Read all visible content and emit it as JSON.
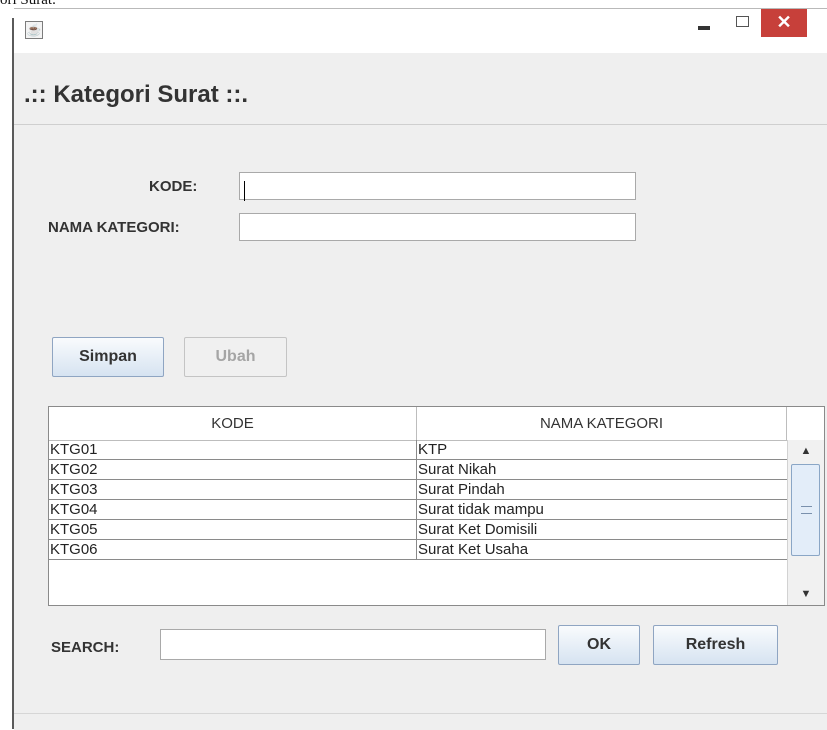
{
  "page": {
    "caption": "ori Surat."
  },
  "window": {
    "app_icon": "java-coffee-icon",
    "close_glyph": "✕"
  },
  "header": {
    "title": ".:: Kategori Surat ::."
  },
  "form": {
    "kode_label": "KODE:",
    "kode_value": "",
    "nama_label": "NAMA KATEGORI:",
    "nama_value": ""
  },
  "buttons": {
    "simpan": "Simpan",
    "ubah": "Ubah"
  },
  "table": {
    "columns": [
      "KODE",
      "NAMA KATEGORI"
    ],
    "rows": [
      {
        "kode": "KTG01",
        "nama": "KTP"
      },
      {
        "kode": "KTG02",
        "nama": "Surat Nikah"
      },
      {
        "kode": "KTG03",
        "nama": "Surat Pindah"
      },
      {
        "kode": "KTG04",
        "nama": "Surat tidak mampu"
      },
      {
        "kode": "KTG05",
        "nama": "Surat Ket Domisili"
      },
      {
        "kode": "KTG06",
        "nama": "Surat Ket Usaha"
      }
    ]
  },
  "search": {
    "label": "SEARCH:",
    "value": "",
    "ok": "OK",
    "refresh": "Refresh"
  },
  "colors": {
    "close_button": "#c7403a",
    "button_border": "#8fa5c2",
    "scroll_thumb": "#e3edf9"
  }
}
